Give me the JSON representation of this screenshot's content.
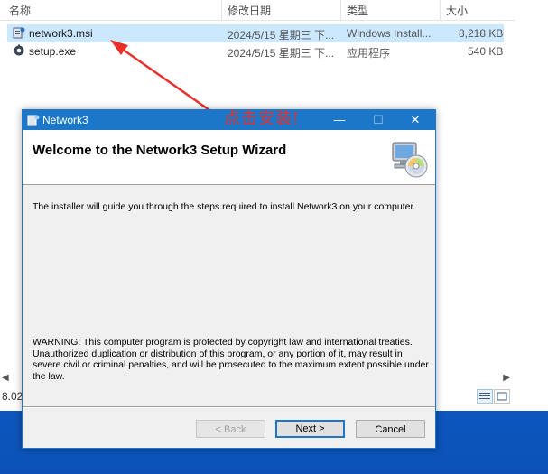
{
  "explorer": {
    "columns": {
      "name": "名称",
      "modified": "修改日期",
      "type": "类型",
      "size": "大小"
    },
    "files": [
      {
        "name": "network3.msi",
        "modified": "2024/5/15 星期三 下...",
        "type": "Windows Install...",
        "size": "8,218 KB",
        "icon": "msi-installer-icon",
        "selected": true
      },
      {
        "name": "setup.exe",
        "modified": "2024/5/15 星期三 下...",
        "type": "应用程序",
        "size": "540 KB",
        "icon": "setup-exe-icon",
        "selected": false
      }
    ],
    "status_text": "8.02"
  },
  "annotation": {
    "text": "点击安装!",
    "color": "#e8302a"
  },
  "dialog": {
    "title": "Network3",
    "controls": {
      "minimize": "—",
      "maximize": "☐",
      "close": "✕"
    },
    "header_title": "Welcome to the Network3 Setup Wizard",
    "body": "The installer will guide you through the steps required to install Network3 on your computer.",
    "warning": "WARNING: This computer program is protected by copyright law and international treaties. Unauthorized duplication or distribution of this program, or any portion of it, may result in severe civil or criminal penalties, and will be prosecuted to the maximum extent possible under the law.",
    "buttons": {
      "back": "< Back",
      "next": "Next >",
      "cancel": "Cancel"
    },
    "accent": "#1c77c9"
  }
}
